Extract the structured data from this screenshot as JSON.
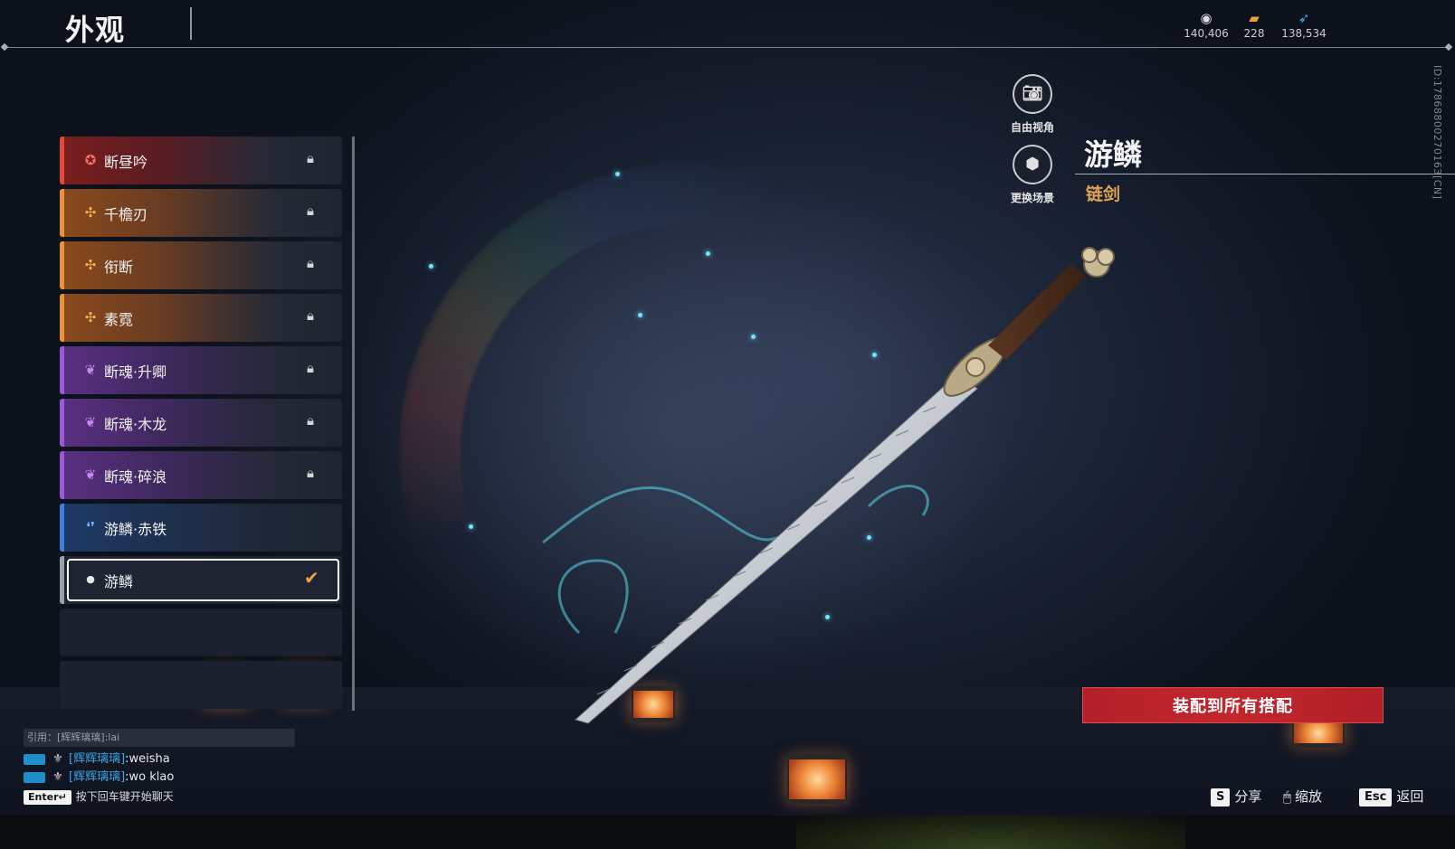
{
  "header": {
    "title": "外观"
  },
  "currencies": [
    {
      "icon": "coin-icon",
      "value": "140,406"
    },
    {
      "icon": "ticket-icon",
      "value": "228"
    },
    {
      "icon": "feather-icon",
      "value": "138,534"
    }
  ],
  "vertical_id": "ID:1786880027016З[CN]",
  "items": [
    {
      "label": "断昼吟",
      "rarity": "red",
      "locked": true
    },
    {
      "label": "千檐刃",
      "rarity": "orange",
      "locked": true
    },
    {
      "label": "衔断",
      "rarity": "orange",
      "locked": true
    },
    {
      "label": "素霓",
      "rarity": "orange",
      "locked": true
    },
    {
      "label": "断魂·升卿",
      "rarity": "purple",
      "locked": true
    },
    {
      "label": "断魂·木龙",
      "rarity": "purple",
      "locked": true
    },
    {
      "label": "断魂·碎浪",
      "rarity": "purple",
      "locked": true
    },
    {
      "label": "游鳞·赤铁",
      "rarity": "blue",
      "locked": false
    },
    {
      "label": "游鳞",
      "rarity": "grey",
      "locked": false,
      "selected": true
    }
  ],
  "camera": {
    "free_view": "自由视角",
    "change_scene": "更换场景"
  },
  "weapon": {
    "name": "游鳞",
    "type": "链剑"
  },
  "equip_all_label": "装配到所有搭配",
  "chat": {
    "quote": "引用：[辉辉璃璃]:lai",
    "lines": [
      {
        "user": "[辉辉璃璃]",
        "text": ":weisha"
      },
      {
        "user": "[辉辉璃璃]",
        "text": ":wo klao"
      }
    ],
    "enter_key": "Enter↵",
    "enter_hint": "按下回车键开始聊天"
  },
  "hints": {
    "share_key": "S",
    "share_label": "分享",
    "zoom_label": "缩放",
    "back_key": "Esc",
    "back_label": "返回"
  },
  "colors": {
    "accent_red": "#c3262d",
    "selected_check": "#f0a350",
    "type_gold": "#e0a452"
  }
}
